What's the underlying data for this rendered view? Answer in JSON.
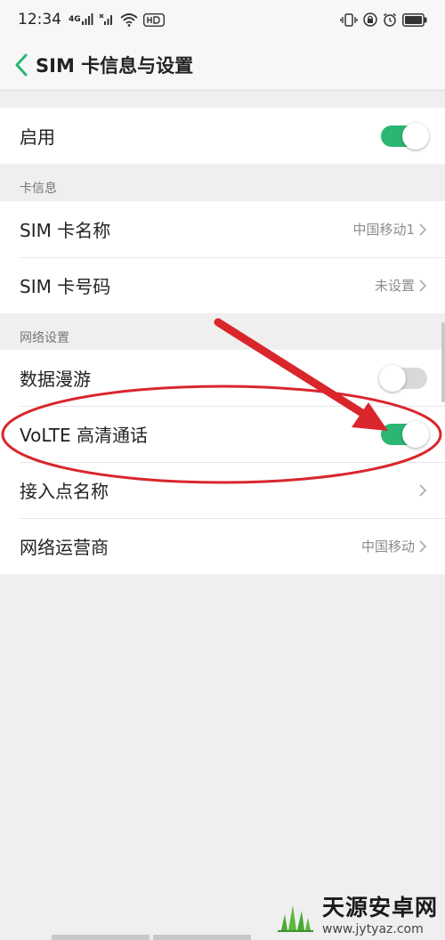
{
  "status_bar": {
    "time": "12:34",
    "network_label": "4G"
  },
  "header": {
    "title": "SIM 卡信息与设置"
  },
  "enable_section": {
    "label": "启用",
    "enabled": true
  },
  "card_info": {
    "section_label": "卡信息",
    "sim_name": {
      "label": "SIM 卡名称",
      "value": "中国移动1"
    },
    "sim_number": {
      "label": "SIM 卡号码",
      "value": "未设置"
    }
  },
  "network_settings": {
    "section_label": "网络设置",
    "data_roaming": {
      "label": "数据漫游",
      "enabled": false
    },
    "volte": {
      "label": "VoLTE 高清通话",
      "enabled": true
    },
    "apn": {
      "label": "接入点名称"
    },
    "carrier": {
      "label": "网络运营商",
      "value": "中国移动"
    }
  },
  "watermark": {
    "name": "天源安卓网",
    "url": "www.jytyaz.com"
  },
  "colors": {
    "toggle_on": "#2bb673",
    "toggle_off": "#d9d9d9",
    "annotation": "#d9262c",
    "background": "#efefef"
  }
}
